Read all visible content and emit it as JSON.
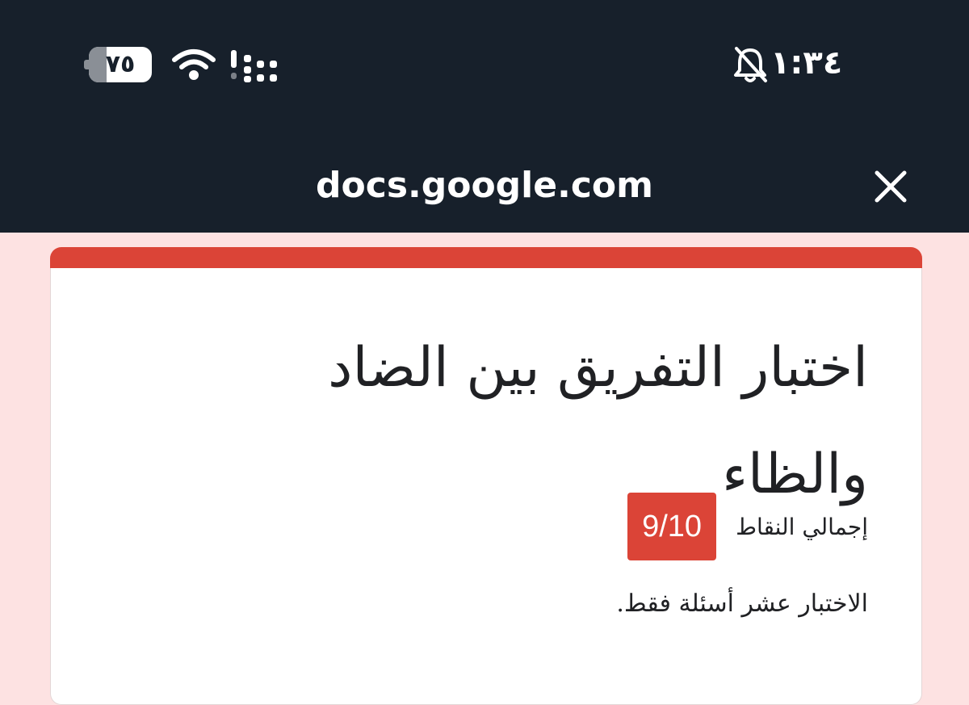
{
  "status_bar": {
    "battery_level": "٧٥",
    "clock": "١:٣٤",
    "icons": [
      "battery-icon",
      "wifi-icon",
      "signal-icon",
      "mute-bell-icon"
    ]
  },
  "browser": {
    "url": "docs.google.com",
    "close_icon": "close-icon"
  },
  "form": {
    "title": "اختبار التفريق بين الضاد والظاء",
    "score_label": "إجمالي النقاط",
    "score": "9/10",
    "description": "الاختبار عشر أسئلة فقط."
  },
  "colors": {
    "topbar": "#17202b",
    "page_background": "#fde2e2",
    "accent": "#db4437",
    "card": "#ffffff"
  }
}
